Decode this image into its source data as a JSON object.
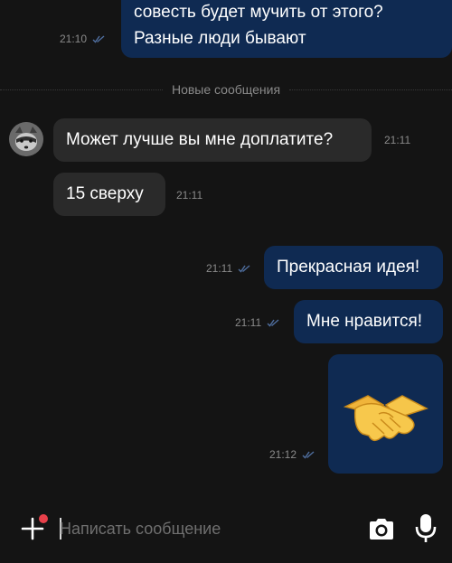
{
  "messages": {
    "m1": {
      "line1": "совесть будет мучить от этого?",
      "line2": "Разные люди бывают",
      "time": "21:10"
    },
    "m2": {
      "text": "Может лучше вы мне доплатите?",
      "time": "21:11"
    },
    "m3": {
      "text": "15 сверху",
      "time": "21:11"
    },
    "m4": {
      "text": "Прекрасная идея!",
      "time": "21:11"
    },
    "m5": {
      "text": "Мне нравится!",
      "time": "21:11"
    },
    "m6": {
      "emoji": "handshake",
      "time": "21:12"
    }
  },
  "divider": {
    "label": "Новые сообщения"
  },
  "composer": {
    "placeholder": "Написать сообщение"
  },
  "colors": {
    "background": "#141414",
    "outgoing_bubble": "#0f2a52",
    "incoming_bubble": "#2a2a2a",
    "badge": "#e8404a",
    "ticks": "#4f6e9e"
  }
}
